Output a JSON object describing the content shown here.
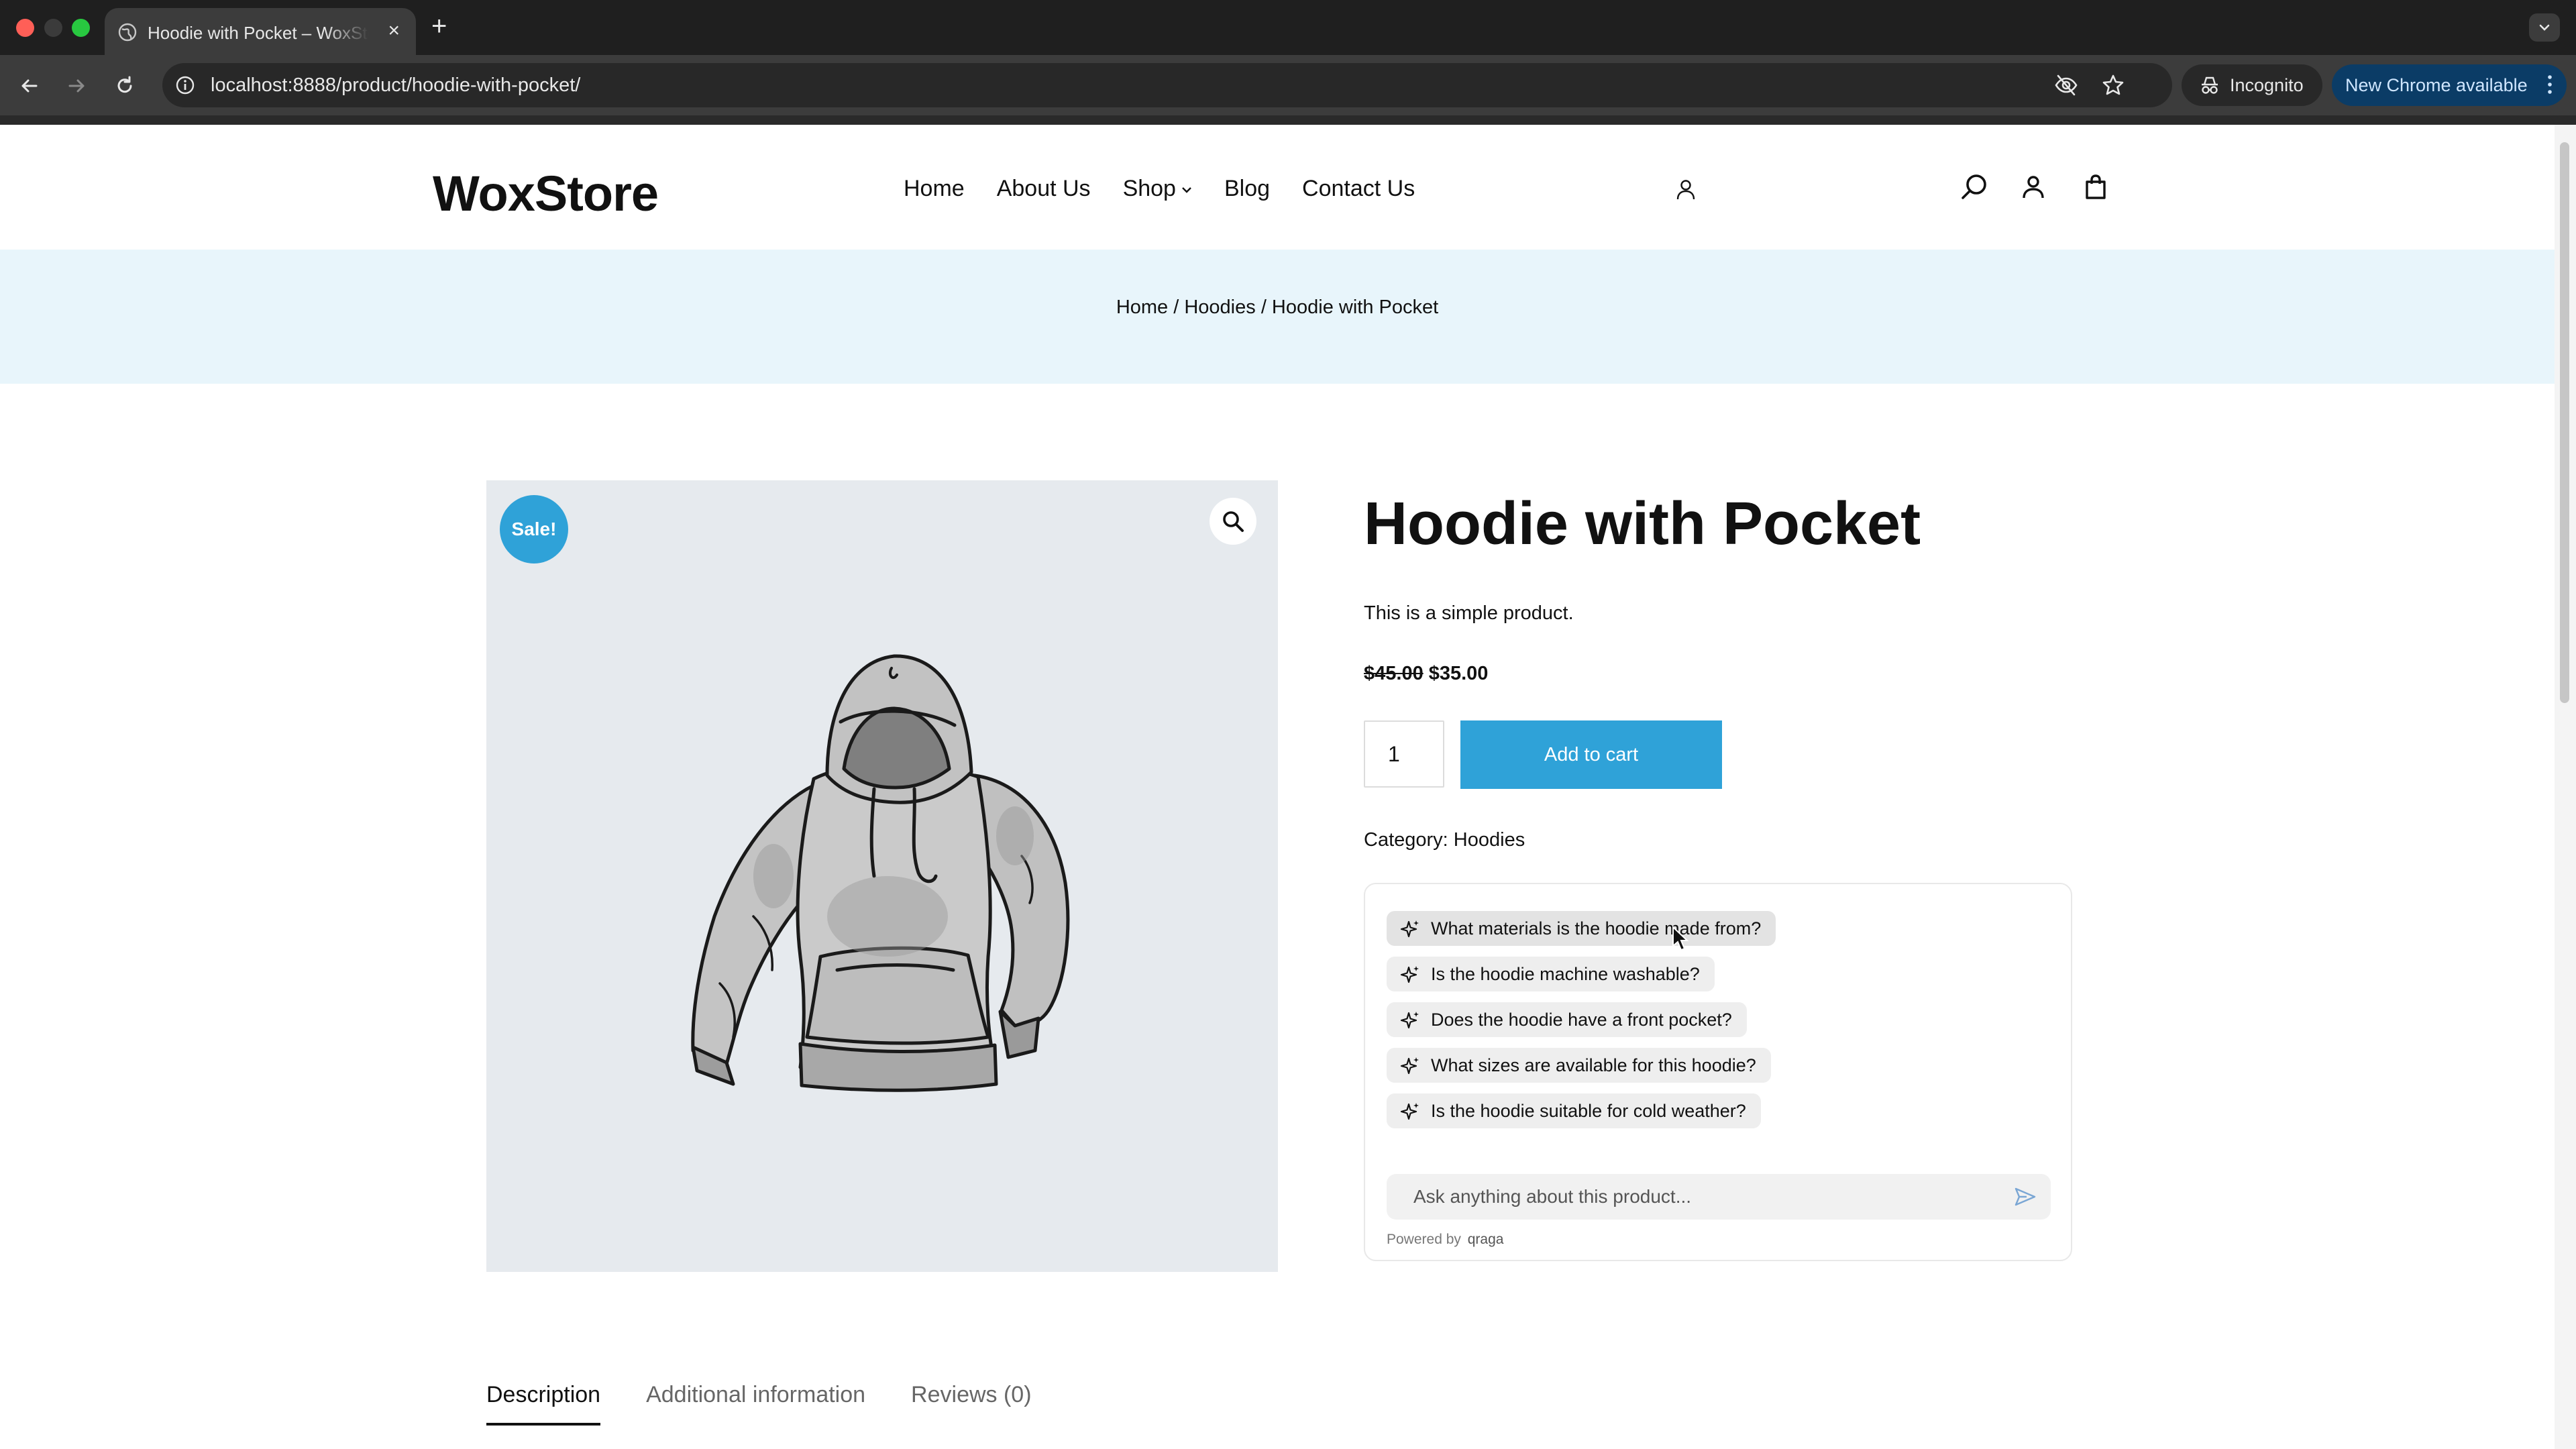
{
  "browser": {
    "tab_title": "Hoodie with Pocket – WoxStore",
    "url": "localhost:8888/product/hoodie-with-pocket/",
    "incognito_label": "Incognito",
    "update_label": "New Chrome available"
  },
  "header": {
    "logo": "WoxStore",
    "nav": {
      "home": "Home",
      "about": "About Us",
      "shop": "Shop",
      "blog": "Blog",
      "contact": "Contact Us"
    }
  },
  "breadcrumb": {
    "text": "Home / Hoodies / Hoodie with Pocket"
  },
  "gallery": {
    "sale_badge": "Sale!"
  },
  "product": {
    "title": "Hoodie with Pocket",
    "short_description": "This is a simple product.",
    "price_regular": "$45.00",
    "price_sale": "$35.00",
    "quantity": "1",
    "add_to_cart": "Add to cart",
    "category_label": "Category: ",
    "category_value": "Hoodies"
  },
  "assistant": {
    "suggestions": [
      "What materials is the hoodie made from?",
      "Is the hoodie machine washable?",
      "Does the hoodie have a front pocket?",
      "What sizes are available for this hoodie?",
      "Is the hoodie suitable for cold weather?"
    ],
    "input_placeholder": "Ask anything about this product...",
    "powered_by": "Powered by",
    "brand": "qraga"
  },
  "tabs": {
    "description": "Description",
    "additional": "Additional information",
    "reviews": "Reviews (0)"
  },
  "colors": {
    "accent": "#2fa2d8",
    "breadcrumb_bg": "#e8f5fb",
    "gallery_bg": "#e6eaee"
  }
}
